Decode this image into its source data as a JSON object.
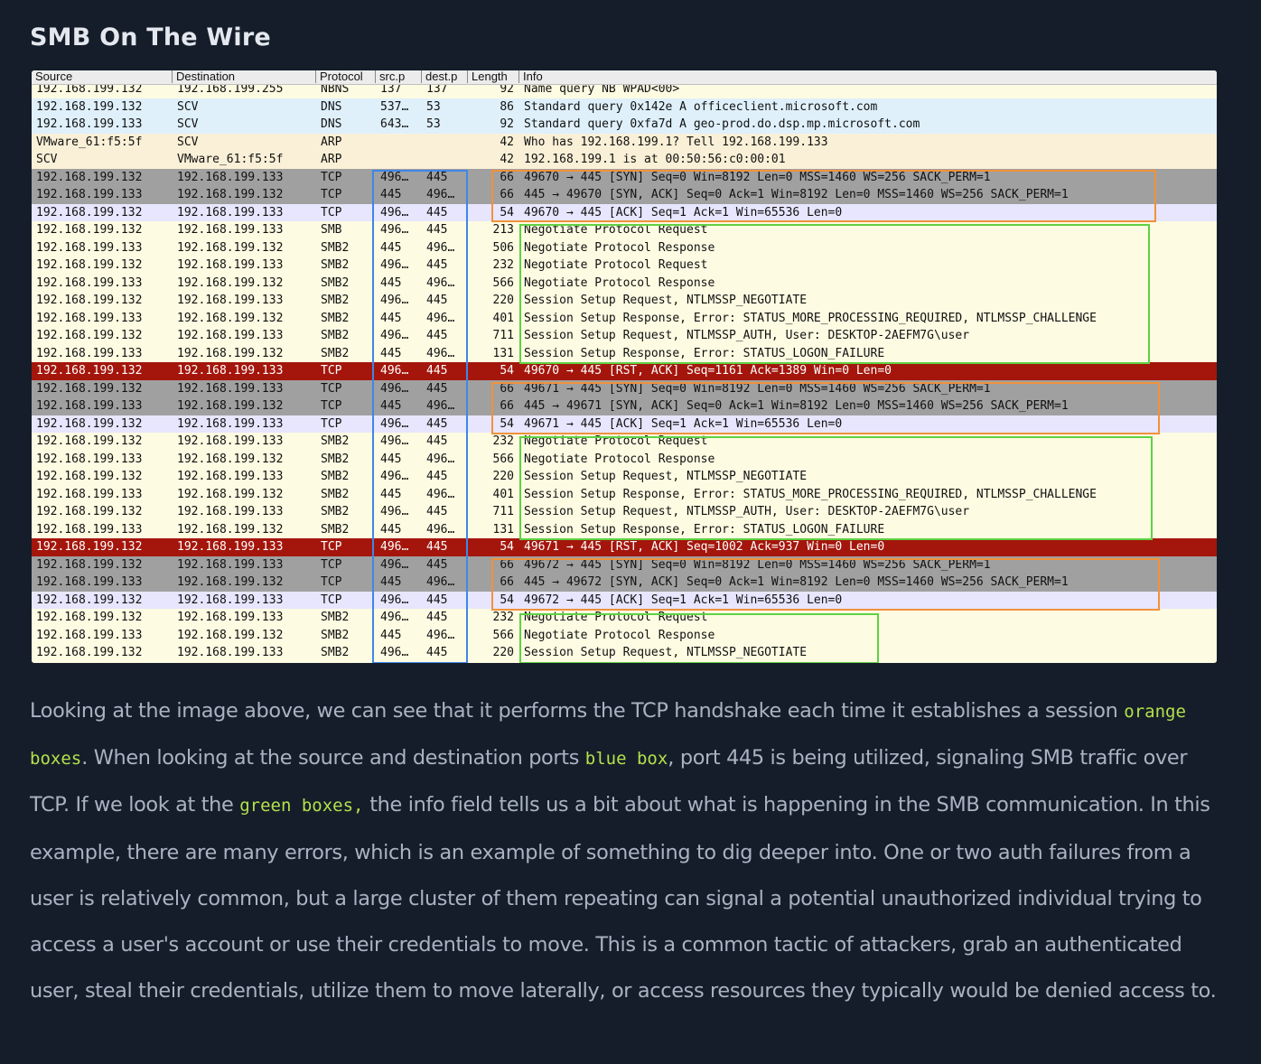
{
  "title": "SMB On The Wire",
  "capture": {
    "columns": [
      "Source",
      "Destination",
      "Protocol",
      "src.p",
      "dest.p",
      "Length",
      "Info"
    ],
    "row_colors": {
      "dns": "#dff0fb",
      "arp": "#faf0d7",
      "tcp_syn": "#a0a0a0",
      "tcp": "#e7e6fe",
      "smb": "#fdfbe2",
      "rst": "#a4160c"
    },
    "rows": [
      {
        "src": "192.168.199.132",
        "dst": "192.168.199.255",
        "proto": "NBNS",
        "sp": "137",
        "dp": "137",
        "len": "92",
        "info": "Name query NB WPAD<00>",
        "style": "smb"
      },
      {
        "src": "192.168.199.132",
        "dst": "SCV",
        "proto": "DNS",
        "sp": "537…",
        "dp": "53",
        "len": "86",
        "info": "Standard query 0x142e A officeclient.microsoft.com",
        "style": "dns"
      },
      {
        "src": "192.168.199.133",
        "dst": "SCV",
        "proto": "DNS",
        "sp": "643…",
        "dp": "53",
        "len": "92",
        "info": "Standard query 0xfa7d A geo-prod.do.dsp.mp.microsoft.com",
        "style": "dns"
      },
      {
        "src": "VMware_61:f5:5f",
        "dst": "SCV",
        "proto": "ARP",
        "sp": "",
        "dp": "",
        "len": "42",
        "info": "Who has 192.168.199.1? Tell 192.168.199.133",
        "style": "arp"
      },
      {
        "src": "SCV",
        "dst": "VMware_61:f5:5f",
        "proto": "ARP",
        "sp": "",
        "dp": "",
        "len": "42",
        "info": "192.168.199.1 is at 00:50:56:c0:00:01",
        "style": "arp"
      },
      {
        "src": "192.168.199.132",
        "dst": "192.168.199.133",
        "proto": "TCP",
        "sp": "496…",
        "dp": "445",
        "len": "66",
        "info": "49670 → 445 [SYN] Seq=0 Win=8192 Len=0 MSS=1460 WS=256 SACK_PERM=1",
        "style": "tcp_syn"
      },
      {
        "src": "192.168.199.133",
        "dst": "192.168.199.132",
        "proto": "TCP",
        "sp": "445",
        "dp": "496…",
        "len": "66",
        "info": "445 → 49670 [SYN, ACK] Seq=0 Ack=1 Win=8192 Len=0 MSS=1460 WS=256 SACK_PERM=1",
        "style": "tcp_syn"
      },
      {
        "src": "192.168.199.132",
        "dst": "192.168.199.133",
        "proto": "TCP",
        "sp": "496…",
        "dp": "445",
        "len": "54",
        "info": "49670 → 445 [ACK] Seq=1 Ack=1 Win=65536 Len=0",
        "style": "tcp"
      },
      {
        "src": "192.168.199.132",
        "dst": "192.168.199.133",
        "proto": "SMB",
        "sp": "496…",
        "dp": "445",
        "len": "213",
        "info": "Negotiate Protocol Request",
        "style": "smb"
      },
      {
        "src": "192.168.199.133",
        "dst": "192.168.199.132",
        "proto": "SMB2",
        "sp": "445",
        "dp": "496…",
        "len": "506",
        "info": "Negotiate Protocol Response",
        "style": "smb"
      },
      {
        "src": "192.168.199.132",
        "dst": "192.168.199.133",
        "proto": "SMB2",
        "sp": "496…",
        "dp": "445",
        "len": "232",
        "info": "Negotiate Protocol Request",
        "style": "smb"
      },
      {
        "src": "192.168.199.133",
        "dst": "192.168.199.132",
        "proto": "SMB2",
        "sp": "445",
        "dp": "496…",
        "len": "566",
        "info": "Negotiate Protocol Response",
        "style": "smb"
      },
      {
        "src": "192.168.199.132",
        "dst": "192.168.199.133",
        "proto": "SMB2",
        "sp": "496…",
        "dp": "445",
        "len": "220",
        "info": "Session Setup Request, NTLMSSP_NEGOTIATE",
        "style": "smb"
      },
      {
        "src": "192.168.199.133",
        "dst": "192.168.199.132",
        "proto": "SMB2",
        "sp": "445",
        "dp": "496…",
        "len": "401",
        "info": "Session Setup Response, Error: STATUS_MORE_PROCESSING_REQUIRED, NTLMSSP_CHALLENGE",
        "style": "smb"
      },
      {
        "src": "192.168.199.132",
        "dst": "192.168.199.133",
        "proto": "SMB2",
        "sp": "496…",
        "dp": "445",
        "len": "711",
        "info": "Session Setup Request, NTLMSSP_AUTH, User: DESKTOP-2AEFM7G\\user",
        "style": "smb"
      },
      {
        "src": "192.168.199.133",
        "dst": "192.168.199.132",
        "proto": "SMB2",
        "sp": "445",
        "dp": "496…",
        "len": "131",
        "info": "Session Setup Response, Error: STATUS_LOGON_FAILURE",
        "style": "smb"
      },
      {
        "src": "192.168.199.132",
        "dst": "192.168.199.133",
        "proto": "TCP",
        "sp": "496…",
        "dp": "445",
        "len": "54",
        "info": "49670 → 445 [RST, ACK] Seq=1161 Ack=1389 Win=0 Len=0",
        "style": "rst"
      },
      {
        "src": "192.168.199.132",
        "dst": "192.168.199.133",
        "proto": "TCP",
        "sp": "496…",
        "dp": "445",
        "len": "66",
        "info": "49671 → 445 [SYN] Seq=0 Win=8192 Len=0 MSS=1460 WS=256 SACK_PERM=1",
        "style": "tcp_syn"
      },
      {
        "src": "192.168.199.133",
        "dst": "192.168.199.132",
        "proto": "TCP",
        "sp": "445",
        "dp": "496…",
        "len": "66",
        "info": "445 → 49671 [SYN, ACK] Seq=0 Ack=1 Win=8192 Len=0 MSS=1460 WS=256 SACK_PERM=1",
        "style": "tcp_syn"
      },
      {
        "src": "192.168.199.132",
        "dst": "192.168.199.133",
        "proto": "TCP",
        "sp": "496…",
        "dp": "445",
        "len": "54",
        "info": "49671 → 445 [ACK] Seq=1 Ack=1 Win=65536 Len=0",
        "style": "tcp"
      },
      {
        "src": "192.168.199.132",
        "dst": "192.168.199.133",
        "proto": "SMB2",
        "sp": "496…",
        "dp": "445",
        "len": "232",
        "info": "Negotiate Protocol Request",
        "style": "smb"
      },
      {
        "src": "192.168.199.133",
        "dst": "192.168.199.132",
        "proto": "SMB2",
        "sp": "445",
        "dp": "496…",
        "len": "566",
        "info": "Negotiate Protocol Response",
        "style": "smb"
      },
      {
        "src": "192.168.199.132",
        "dst": "192.168.199.133",
        "proto": "SMB2",
        "sp": "496…",
        "dp": "445",
        "len": "220",
        "info": "Session Setup Request, NTLMSSP_NEGOTIATE",
        "style": "smb"
      },
      {
        "src": "192.168.199.133",
        "dst": "192.168.199.132",
        "proto": "SMB2",
        "sp": "445",
        "dp": "496…",
        "len": "401",
        "info": "Session Setup Response, Error: STATUS_MORE_PROCESSING_REQUIRED, NTLMSSP_CHALLENGE",
        "style": "smb"
      },
      {
        "src": "192.168.199.132",
        "dst": "192.168.199.133",
        "proto": "SMB2",
        "sp": "496…",
        "dp": "445",
        "len": "711",
        "info": "Session Setup Request, NTLMSSP_AUTH, User: DESKTOP-2AEFM7G\\user",
        "style": "smb"
      },
      {
        "src": "192.168.199.133",
        "dst": "192.168.199.132",
        "proto": "SMB2",
        "sp": "445",
        "dp": "496…",
        "len": "131",
        "info": "Session Setup Response, Error: STATUS_LOGON_FAILURE",
        "style": "smb"
      },
      {
        "src": "192.168.199.132",
        "dst": "192.168.199.133",
        "proto": "TCP",
        "sp": "496…",
        "dp": "445",
        "len": "54",
        "info": "49671 → 445 [RST, ACK] Seq=1002 Ack=937 Win=0 Len=0",
        "style": "rst"
      },
      {
        "src": "192.168.199.132",
        "dst": "192.168.199.133",
        "proto": "TCP",
        "sp": "496…",
        "dp": "445",
        "len": "66",
        "info": "49672 → 445 [SYN] Seq=0 Win=8192 Len=0 MSS=1460 WS=256 SACK_PERM=1",
        "style": "tcp_syn"
      },
      {
        "src": "192.168.199.133",
        "dst": "192.168.199.132",
        "proto": "TCP",
        "sp": "445",
        "dp": "496…",
        "len": "66",
        "info": "445 → 49672 [SYN, ACK] Seq=0 Ack=1 Win=8192 Len=0 MSS=1460 WS=256 SACK_PERM=1",
        "style": "tcp_syn"
      },
      {
        "src": "192.168.199.132",
        "dst": "192.168.199.133",
        "proto": "TCP",
        "sp": "496…",
        "dp": "445",
        "len": "54",
        "info": "49672 → 445 [ACK] Seq=1 Ack=1 Win=65536 Len=0",
        "style": "tcp"
      },
      {
        "src": "192.168.199.132",
        "dst": "192.168.199.133",
        "proto": "SMB2",
        "sp": "496…",
        "dp": "445",
        "len": "232",
        "info": "Negotiate Protocol Request",
        "style": "smb"
      },
      {
        "src": "192.168.199.133",
        "dst": "192.168.199.132",
        "proto": "SMB2",
        "sp": "445",
        "dp": "496…",
        "len": "566",
        "info": "Negotiate Protocol Response",
        "style": "smb"
      },
      {
        "src": "192.168.199.132",
        "dst": "192.168.199.133",
        "proto": "SMB2",
        "sp": "496…",
        "dp": "445",
        "len": "220",
        "info": "Session Setup Request, NTLMSSP_NEGOTIATE",
        "style": "smb"
      }
    ]
  },
  "article": {
    "p1": "Looking at the image above, we can see that it performs the TCP handshake each time it establishes a session ",
    "code1": "orange boxes",
    "p2": ". When looking at the source and destination ports ",
    "code2": "blue box",
    "p3": ", port 445 is being utilized, signaling SMB traffic over TCP. If we look at the ",
    "code3": "green boxes,",
    "p4": " the info field tells us a bit about what is happening in the SMB communication. In this example, there are many errors, which is an example of something to dig deeper into. One or two auth failures from a user is relatively common, but a large cluster of them repeating can signal a potential unauthorized individual trying to access a user's account or use their credentials to move. This is a common tactic of attackers, grab an authenticated user, steal their credentials, utilize them to move laterally, or access resources they typically would be denied access to."
  }
}
